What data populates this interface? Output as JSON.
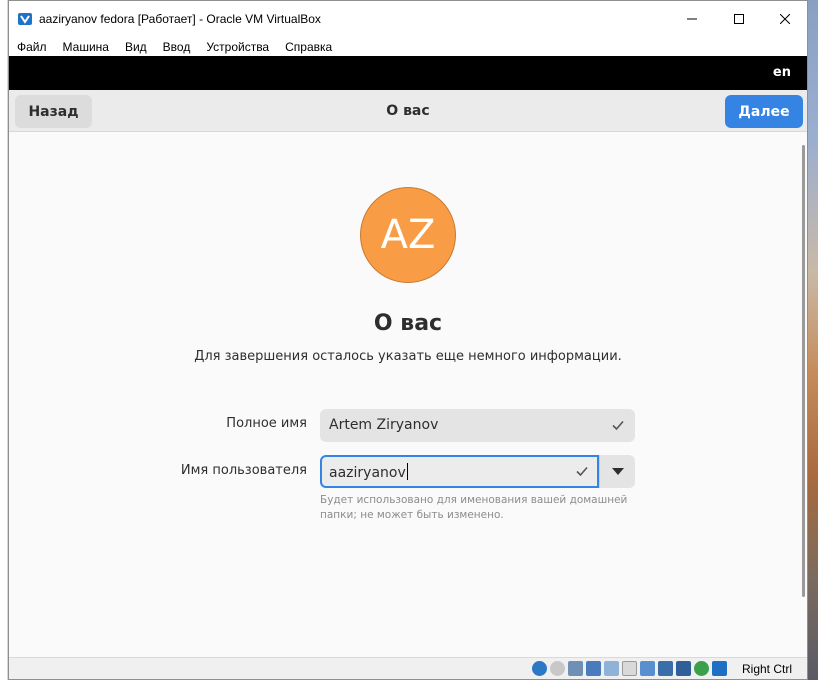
{
  "window": {
    "title": "aaziryanov fedora [Работает] - Oracle VM VirtualBox"
  },
  "menu": [
    "Файл",
    "Машина",
    "Вид",
    "Ввод",
    "Устройства",
    "Справка"
  ],
  "topbar": {
    "language": "en"
  },
  "header": {
    "back_label": "Назад",
    "title": "О вас",
    "next_label": "Далее"
  },
  "avatar": {
    "initials": "AZ",
    "color": "#f89c45"
  },
  "page": {
    "heading": "О вас",
    "subtitle": "Для завершения осталось указать еще немного информации."
  },
  "form": {
    "fullname_label": "Полное имя",
    "fullname_value": "Artem Ziryanov",
    "username_label": "Имя пользователя",
    "username_value": "aaziryanov",
    "username_hint_line1": "Будет использовано для именования вашей домашней",
    "username_hint_line2": "папки; не может быть изменено."
  },
  "statusbar": {
    "host_key": "Right Ctrl"
  },
  "colors": {
    "accent": "#3584e4",
    "topbar": "#000000"
  }
}
